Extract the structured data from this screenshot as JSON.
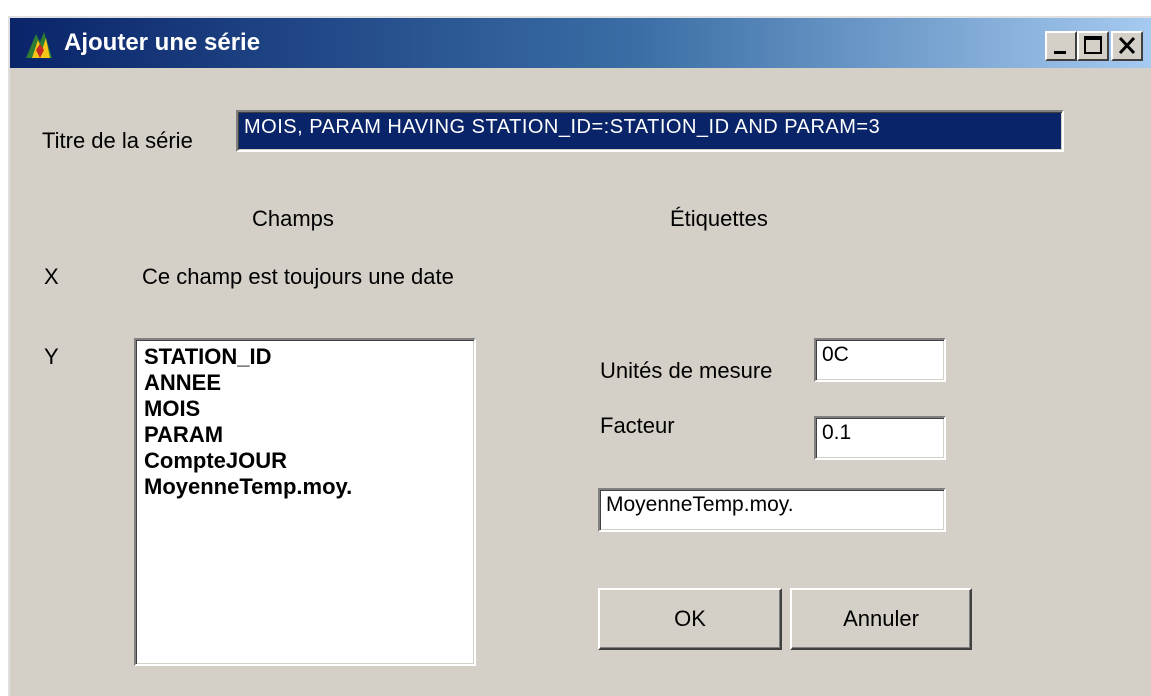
{
  "window": {
    "title": "Ajouter une série",
    "controls": {
      "minimize_icon": "minimize-icon",
      "maximize_icon": "maximize-icon",
      "close_icon": "close-icon"
    }
  },
  "form": {
    "series_title_label": "Titre de la série",
    "series_title_value": "MOIS, PARAM HAVING STATION_ID=:STATION_ID AND PARAM=3",
    "header_fields": "Champs",
    "header_labels": "Étiquettes",
    "x_label": "X",
    "x_note": "Ce champ est toujours une date",
    "y_label": "Y",
    "y_fields": [
      "STATION_ID",
      "ANNEE",
      "MOIS",
      "PARAM",
      "CompteJOUR",
      "MoyenneTemp.moy."
    ],
    "units_label": "Unités de mesure",
    "units_value": "0C",
    "factor_label": "Facteur",
    "factor_value": "0.1",
    "label_value": "MoyenneTemp.moy."
  },
  "buttons": {
    "ok": "OK",
    "cancel": "Annuler"
  },
  "colors": {
    "title_bar_start": "#0a246a",
    "title_bar_end": "#a6caf0",
    "selection": "#0a246a",
    "window_bg": "#d4d0c8"
  }
}
